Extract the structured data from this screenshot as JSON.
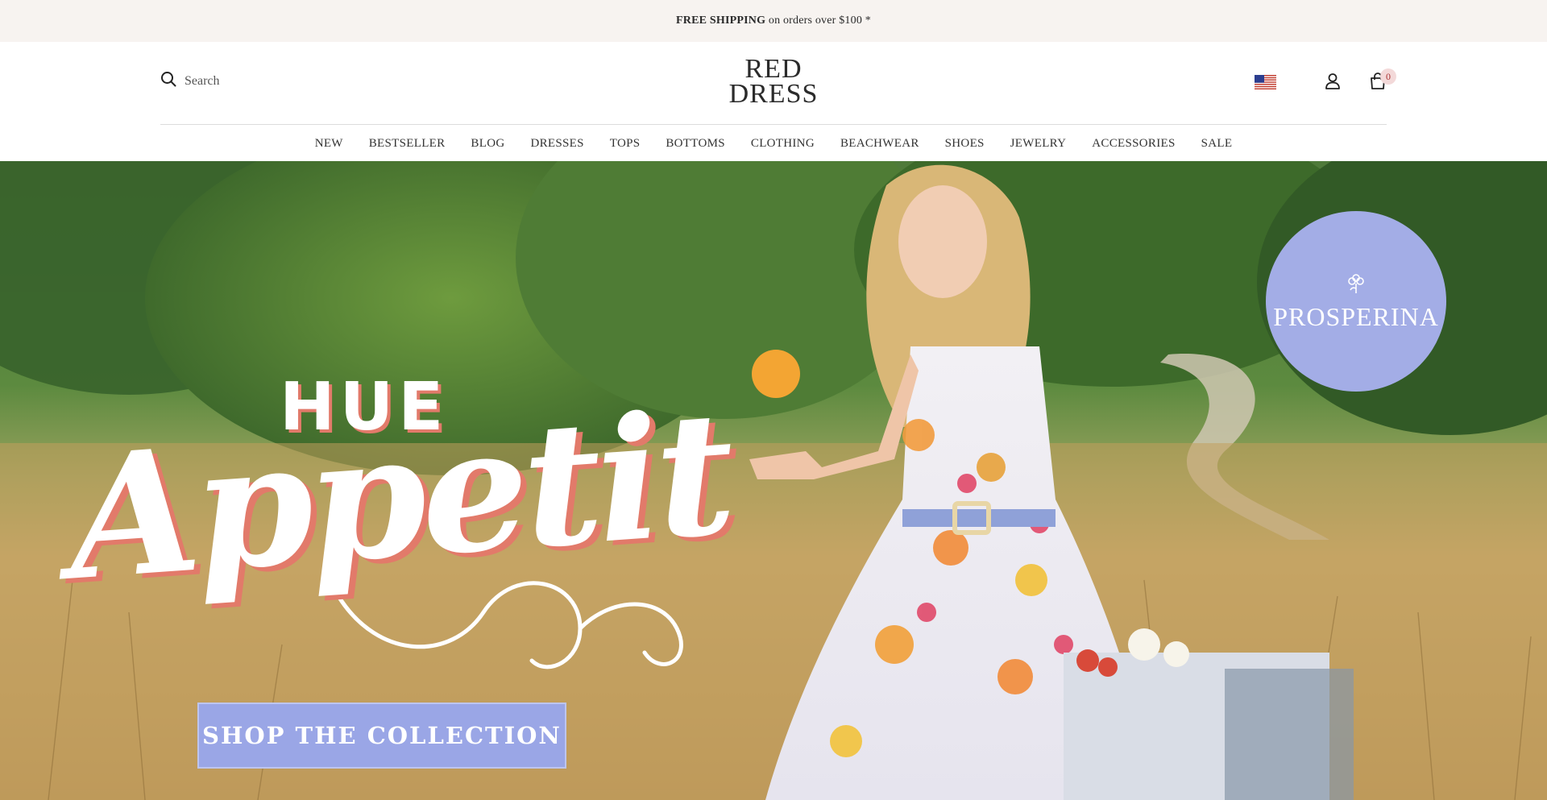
{
  "announcement": {
    "bold": "FREE SHIPPING",
    "rest": " on orders over $100 *"
  },
  "header": {
    "search_placeholder": "Search",
    "logo_line1": "RED",
    "logo_line2": "DRESS",
    "cart_count": "0"
  },
  "nav": [
    "NEW",
    "BESTSELLER",
    "BLOG",
    "DRESSES",
    "TOPS",
    "BOTTOMS",
    "CLOTHING",
    "BEACHWEAR",
    "SHOES",
    "JEWELRY",
    "ACCESSORIES",
    "SALE"
  ],
  "hero": {
    "headline_small": "HUE",
    "headline_script": "Appetit",
    "cta": "SHOP THE COLLECTION",
    "badge": "PROSPERINA"
  },
  "icons": [
    "search-icon",
    "us-flag-icon",
    "account-icon",
    "cart-icon",
    "flower-icon"
  ],
  "colors": {
    "announcement_bg": "#f7f3f0",
    "cta": "#9aa6e6",
    "badge": "#a3ade6",
    "headline_shadow": "#e27a6a"
  }
}
